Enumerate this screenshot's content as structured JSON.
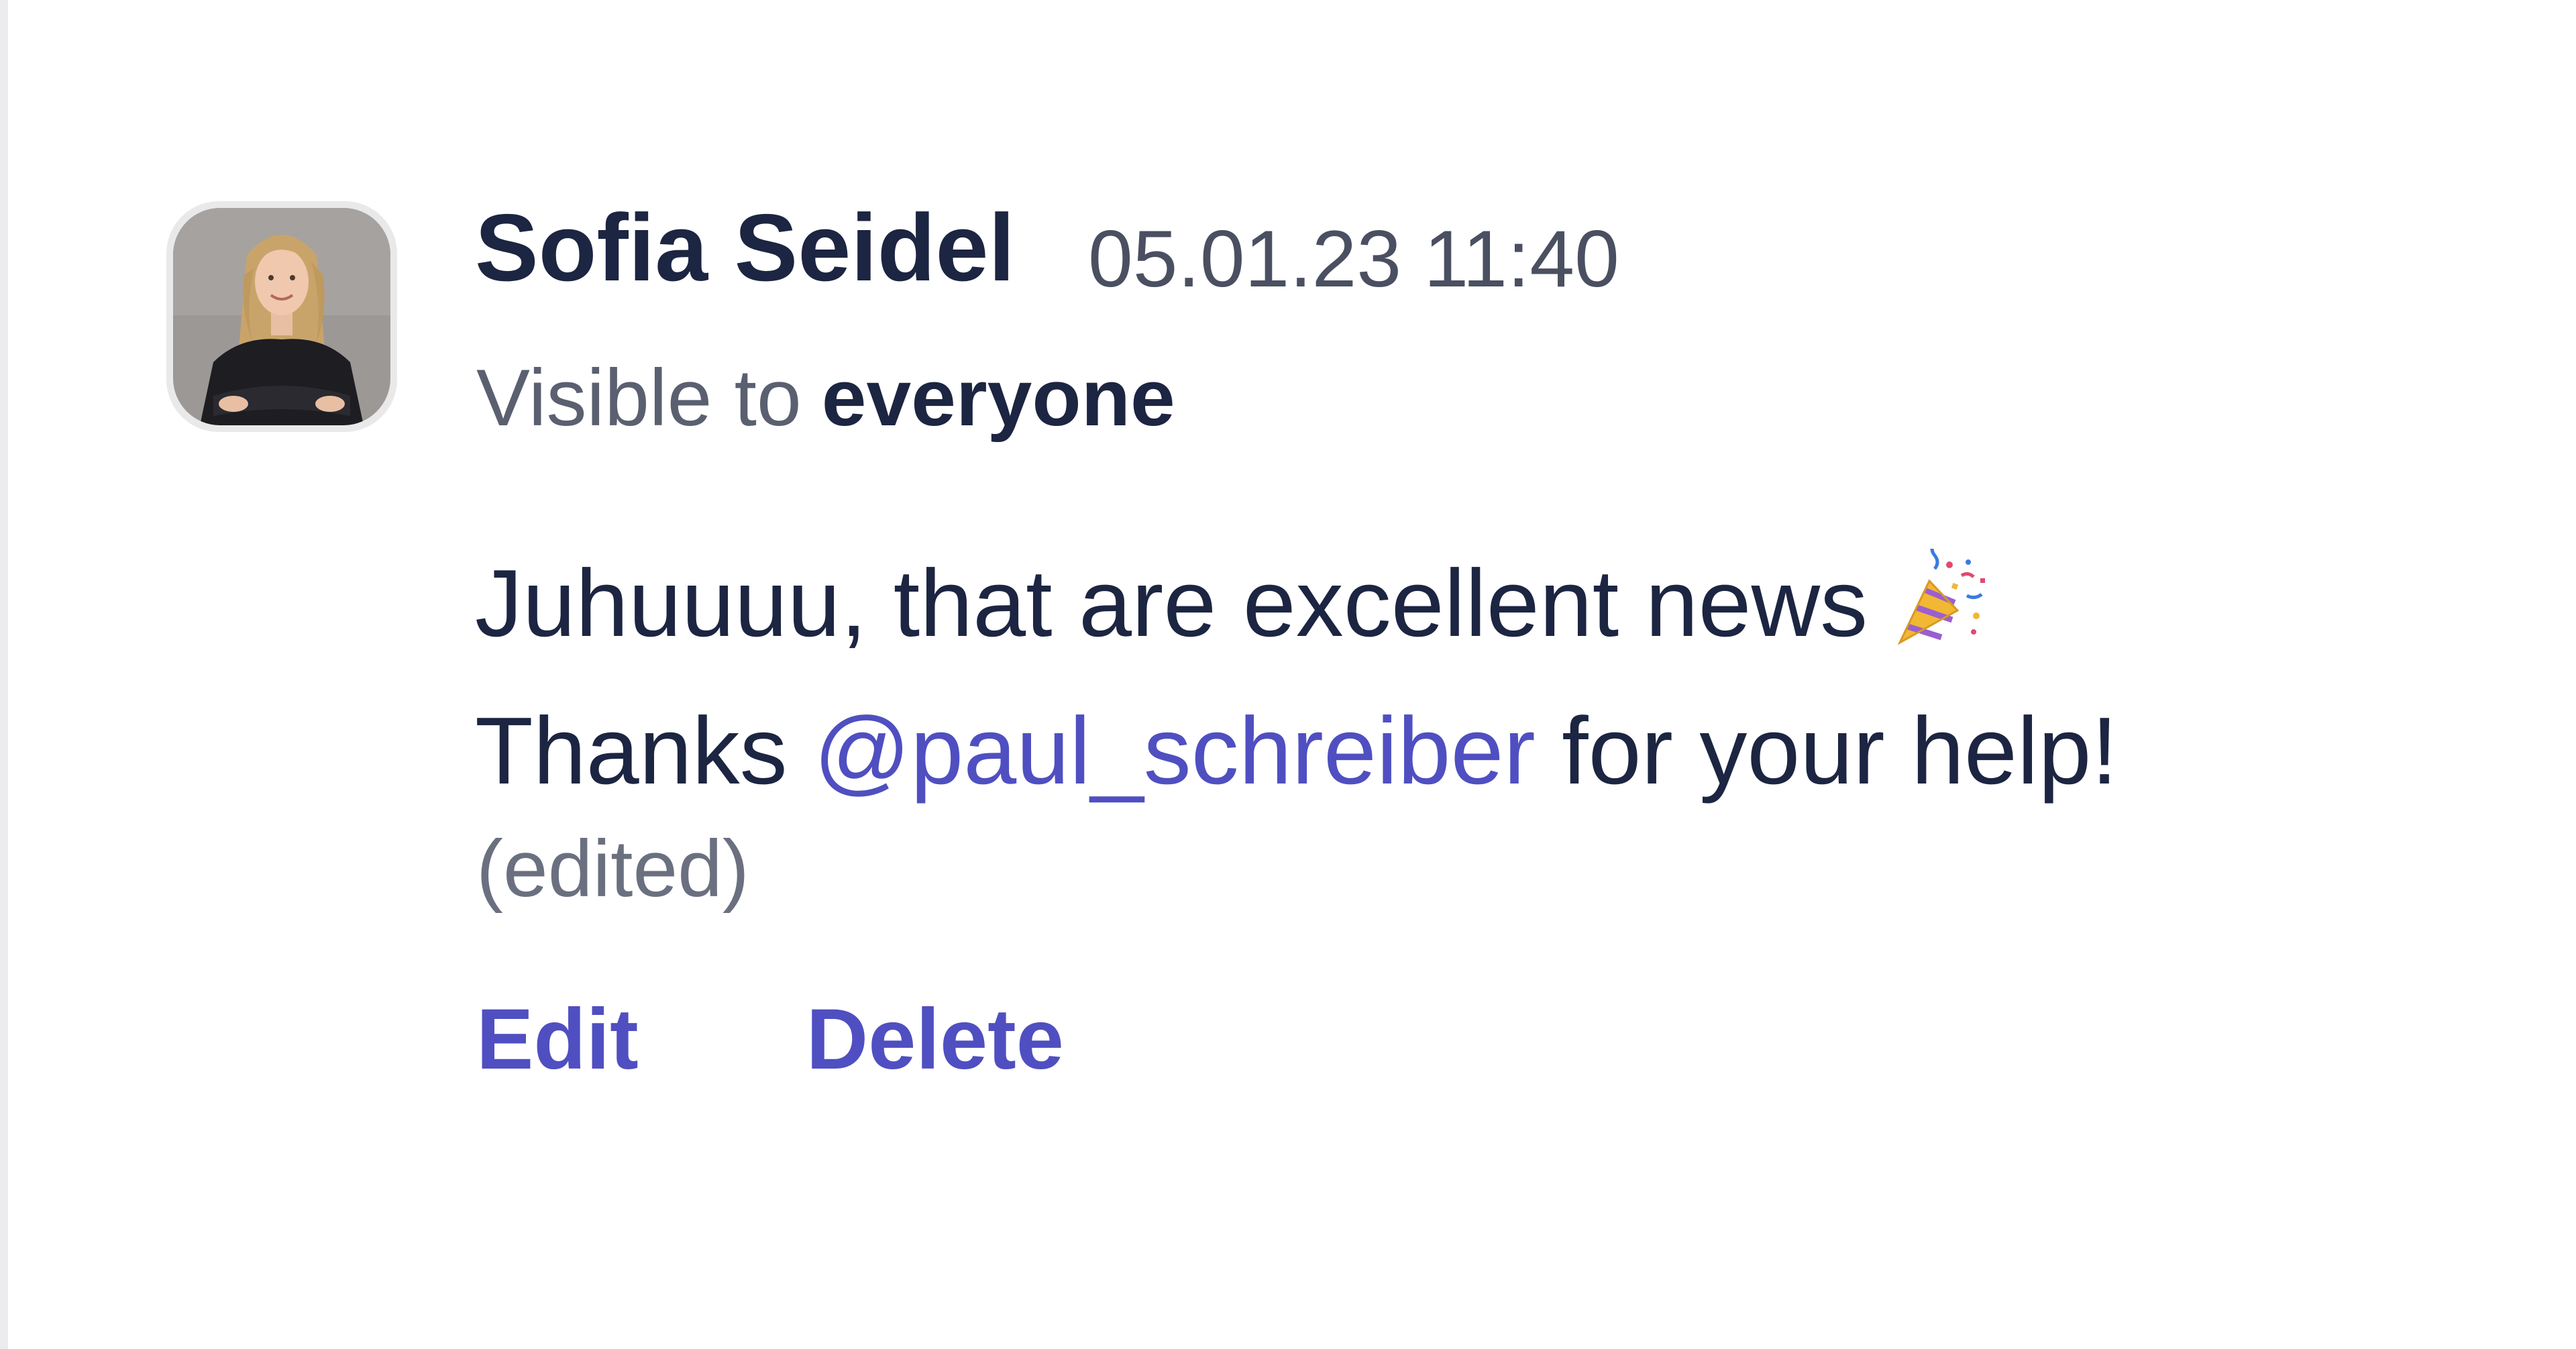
{
  "comment": {
    "author_name": "Sofia Seidel",
    "timestamp": "05.01.23 11:40",
    "visibility_prefix": "Visible to",
    "visibility_target": "everyone",
    "message": {
      "line1": "Juhuuuu, that are excellent news",
      "line1_emoji": "party-popper-emoji",
      "line2_before": "Thanks ",
      "mention": "@paul_schreiber",
      "line2_after": " for your help!"
    },
    "edited_label": "(edited)",
    "actions": {
      "edit_label": "Edit",
      "delete_label": "Delete"
    }
  },
  "colors": {
    "text_primary": "#1c2541",
    "text_secondary": "#5a6070",
    "accent": "#4f4fc1",
    "muted": "#6b7080"
  }
}
